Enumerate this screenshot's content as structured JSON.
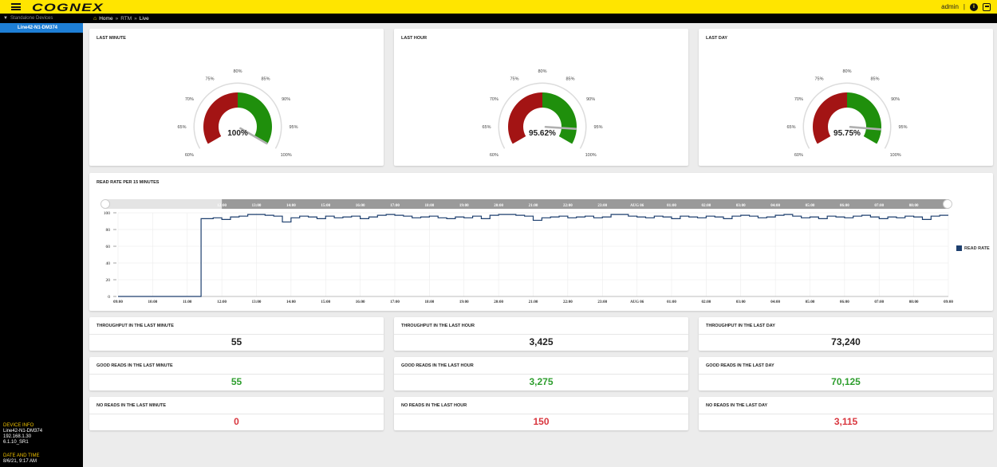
{
  "header": {
    "logo": "COGNEX",
    "user": "admin",
    "separator": "|",
    "info_icon": "i"
  },
  "sidebar": {
    "section_label": "Standalone Devices",
    "device": "Line42-N1-DM374",
    "device_info_label": "DEVICE INFO",
    "device_info": [
      "Line42-N1-DM374",
      "192.168.1.30",
      "6.1.10_SR1"
    ],
    "date_label": "DATE AND TIME",
    "date_value": "8/6/21, 9:17 AM"
  },
  "breadcrumb": {
    "home": "Home",
    "sep": "»",
    "rtm": "RTM",
    "live": "Live"
  },
  "gauges": [
    {
      "title": "LAST MINUTE",
      "value": 100,
      "display": "100%"
    },
    {
      "title": "LAST HOUR",
      "value": 95.62,
      "display": "95.62%"
    },
    {
      "title": "LAST DAY",
      "value": 95.75,
      "display": "95.75%"
    }
  ],
  "gauge_ticks": [
    "60%",
    "65%",
    "70%",
    "75%",
    "80%",
    "85%",
    "90%",
    "95%",
    "100%"
  ],
  "colors": {
    "bad": "#a31414",
    "good": "#1f8f0c",
    "needle": "#b0b0b0",
    "line": "#1d3f6e",
    "good_text": "#2e9e2e",
    "bad_text": "#d9363e"
  },
  "chart_data": {
    "type": "line",
    "title": "READ RATE PER 15 MINUTES",
    "categories": [
      "09:00",
      "10:00",
      "11:00",
      "12:00",
      "13:00",
      "14:00",
      "15:00",
      "16:00",
      "17:00",
      "18:00",
      "19:00",
      "20:00",
      "21:00",
      "22:00",
      "23:00",
      "AUG 06",
      "01:00",
      "02:00",
      "03:00",
      "04:00",
      "05:00",
      "06:00",
      "07:00",
      "08:00",
      "09:00"
    ],
    "navigator_labels": [
      "12:00",
      "13:00",
      "14:00",
      "15:00",
      "16:00",
      "17:00",
      "18:00",
      "19:00",
      "20:00",
      "21:00",
      "22:00",
      "23:00",
      "AUG 06",
      "01:00",
      "02:00",
      "03:00",
      "04:00",
      "05:00",
      "06:00",
      "07:00",
      "08:00"
    ],
    "yticks": [
      0,
      20,
      40,
      60,
      80,
      100
    ],
    "ylim": [
      0,
      100
    ],
    "xlim": [
      0,
      24
    ],
    "series": [
      {
        "name": "READ RATE",
        "x": [
          0,
          2.4,
          2.4,
          2.75,
          3.0,
          3.25,
          3.5,
          3.75,
          4.0,
          4.25,
          4.5,
          4.75,
          5.0,
          5.25,
          5.5,
          5.75,
          6.0,
          6.25,
          6.5,
          6.75,
          7.0,
          7.25,
          7.5,
          7.75,
          8.0,
          8.25,
          8.5,
          8.75,
          9.0,
          9.25,
          9.5,
          9.75,
          10.0,
          10.25,
          10.5,
          10.75,
          11.0,
          11.25,
          11.5,
          11.75,
          12.0,
          12.25,
          12.5,
          12.75,
          13.0,
          13.25,
          13.5,
          13.75,
          14.0,
          14.25,
          14.5,
          14.75,
          15.0,
          15.25,
          15.5,
          15.75,
          16.0,
          16.25,
          16.5,
          16.75,
          17.0,
          17.25,
          17.5,
          17.75,
          18.0,
          18.25,
          18.5,
          18.75,
          19.0,
          19.25,
          19.5,
          19.75,
          20.0,
          20.25,
          20.5,
          20.75,
          21.0,
          21.25,
          21.5,
          21.75,
          22.0,
          22.25,
          22.5,
          22.75,
          23.0,
          23.25,
          23.5,
          23.75,
          24.0
        ],
        "values": [
          0,
          0,
          93,
          94,
          92,
          95,
          96,
          98,
          98,
          97,
          96,
          89,
          94,
          96,
          95,
          93,
          96,
          94,
          95,
          96,
          93,
          95,
          97,
          98,
          97,
          96,
          94,
          95,
          96,
          94,
          93,
          95,
          94,
          96,
          93,
          97,
          98,
          98,
          97,
          96,
          91,
          94,
          95,
          96,
          94,
          95,
          96,
          94,
          95,
          98,
          98,
          96,
          95,
          94,
          96,
          95,
          93,
          96,
          95,
          94,
          96,
          95,
          93,
          96,
          97,
          96,
          94,
          95,
          97,
          98,
          96,
          94,
          95,
          93,
          96,
          95,
          94,
          96,
          97,
          95,
          93,
          95,
          94,
          96,
          95,
          92,
          96,
          97,
          97
        ]
      }
    ]
  },
  "stats": [
    {
      "title": "THROUGHPUT IN THE LAST MINUTE",
      "value": "55",
      "kind": "normal"
    },
    {
      "title": "THROUGHPUT IN THE LAST HOUR",
      "value": "3,425",
      "kind": "normal"
    },
    {
      "title": "THROUGHPUT IN THE LAST DAY",
      "value": "73,240",
      "kind": "normal"
    },
    {
      "title": "GOOD READS IN THE LAST MINUTE",
      "value": "55",
      "kind": "good"
    },
    {
      "title": "GOOD READS IN THE LAST HOUR",
      "value": "3,275",
      "kind": "good"
    },
    {
      "title": "GOOD READS IN THE LAST DAY",
      "value": "70,125",
      "kind": "good"
    },
    {
      "title": "NO READS IN THE LAST MINUTE",
      "value": "0",
      "kind": "bad"
    },
    {
      "title": "NO READS IN THE LAST HOUR",
      "value": "150",
      "kind": "bad"
    },
    {
      "title": "NO READS IN THE LAST DAY",
      "value": "3,115",
      "kind": "bad"
    }
  ]
}
